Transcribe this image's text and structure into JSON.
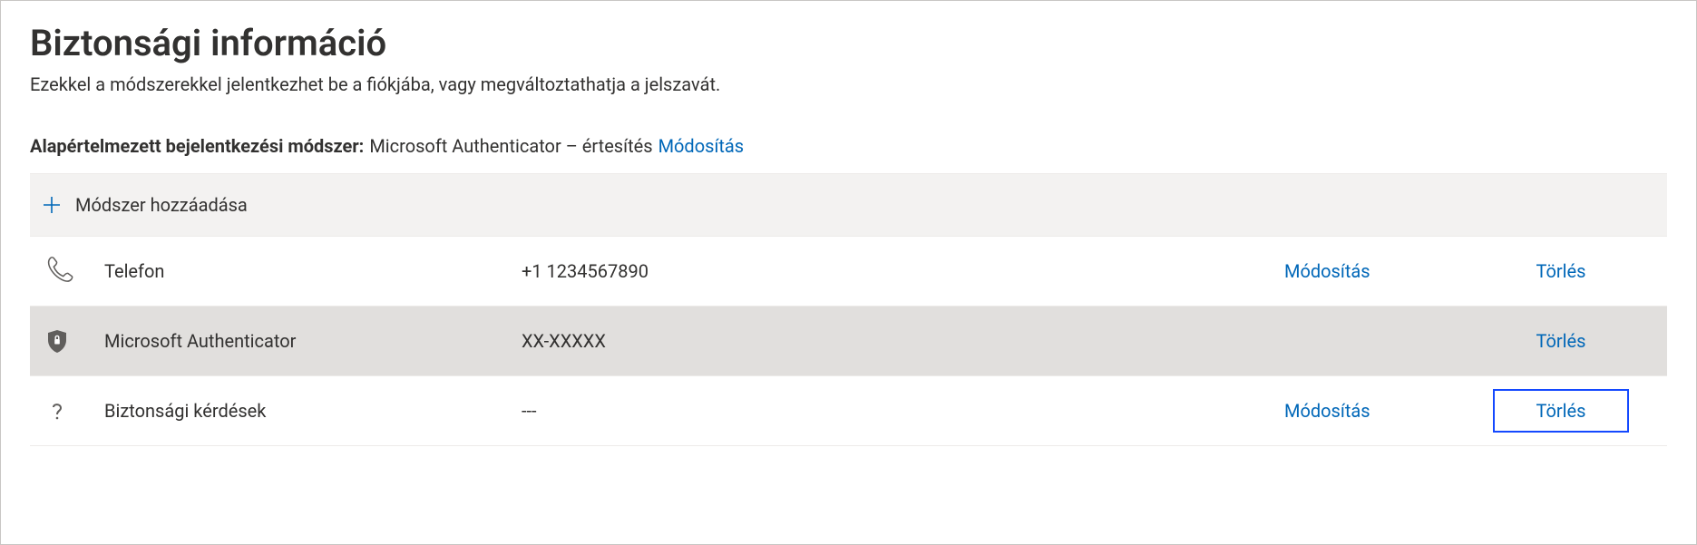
{
  "header": {
    "title": "Biztonsági információ",
    "subtitle": "Ezekkel a módszerekkel jelentkezhet be a fiókjába, vagy megváltoztathatja a jelszavát."
  },
  "default_method": {
    "label": "Alapértelmezett bejelentkezési módszer:",
    "value": "Microsoft Authenticator – értesítés",
    "change_label": "Módosítás"
  },
  "add_method": {
    "label": "Módszer hozzáadása"
  },
  "actions": {
    "change": "Módosítás",
    "delete": "Törlés"
  },
  "methods": [
    {
      "icon": "phone-icon",
      "name": "Telefon",
      "value": "+1 1234567890",
      "can_change": true,
      "alt": false,
      "highlight_delete": false
    },
    {
      "icon": "authenticator-icon",
      "name": "Microsoft Authenticator",
      "value": "XX-XXXXX",
      "can_change": false,
      "alt": true,
      "highlight_delete": false
    },
    {
      "icon": "question-icon",
      "name": "Biztonsági kérdések",
      "value": "---",
      "can_change": true,
      "alt": false,
      "highlight_delete": true
    }
  ]
}
